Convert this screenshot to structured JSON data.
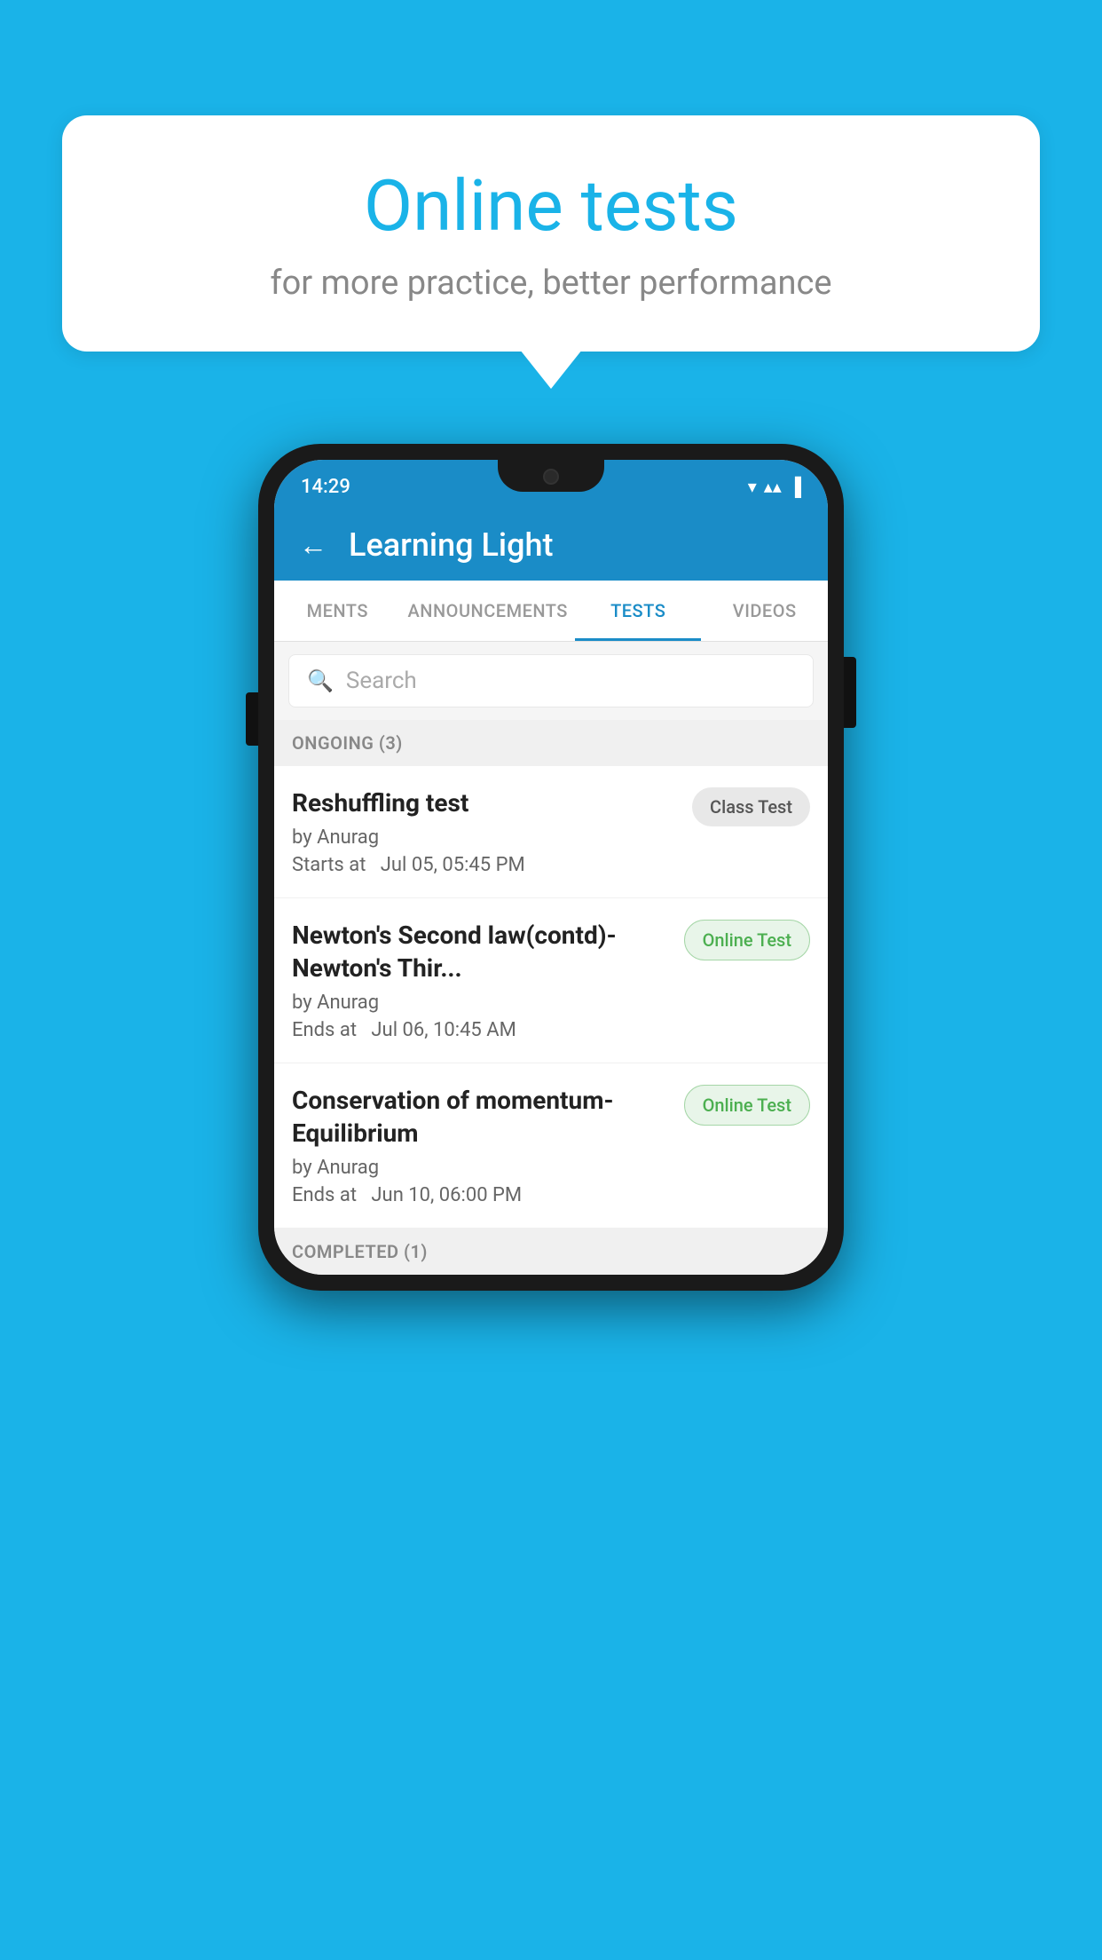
{
  "background": {
    "color": "#1ab3e8"
  },
  "speech_bubble": {
    "title": "Online tests",
    "subtitle": "for more practice, better performance"
  },
  "phone": {
    "status_bar": {
      "time": "14:29",
      "wifi": "▾",
      "signal": "▴▴",
      "battery": "▐"
    },
    "app_header": {
      "back_label": "←",
      "title": "Learning Light"
    },
    "tabs": [
      {
        "label": "MENTS",
        "active": false
      },
      {
        "label": "ANNOUNCEMENTS",
        "active": false
      },
      {
        "label": "TESTS",
        "active": true
      },
      {
        "label": "VIDEOS",
        "active": false
      }
    ],
    "search": {
      "placeholder": "Search"
    },
    "ongoing_section": {
      "header": "ONGOING (3)",
      "tests": [
        {
          "title": "Reshuffling test",
          "author": "by Anurag",
          "time_label": "Starts at",
          "time": "Jul 05, 05:45 PM",
          "badge": "Class Test",
          "badge_type": "class"
        },
        {
          "title": "Newton's Second law(contd)-Newton's Thir...",
          "author": "by Anurag",
          "time_label": "Ends at",
          "time": "Jul 06, 10:45 AM",
          "badge": "Online Test",
          "badge_type": "online"
        },
        {
          "title": "Conservation of momentum-Equilibrium",
          "author": "by Anurag",
          "time_label": "Ends at",
          "time": "Jun 10, 06:00 PM",
          "badge": "Online Test",
          "badge_type": "online"
        }
      ]
    },
    "completed_section": {
      "header": "COMPLETED (1)"
    }
  }
}
